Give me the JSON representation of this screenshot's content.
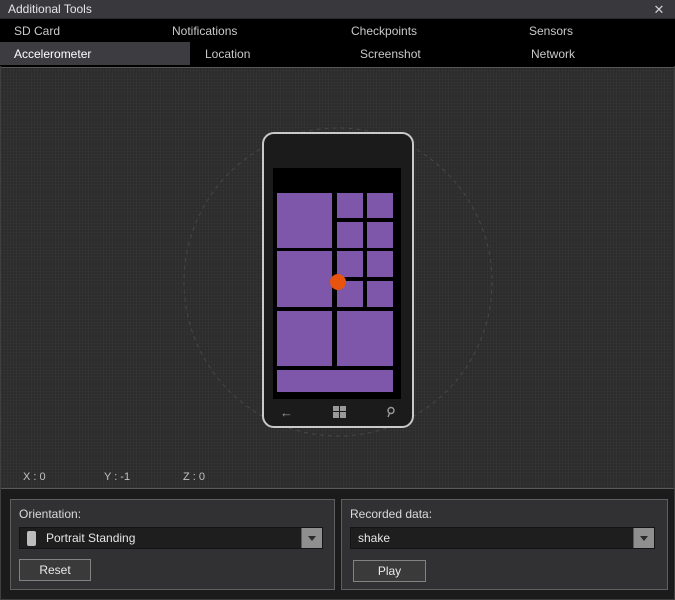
{
  "window": {
    "title": "Additional Tools",
    "close_glyph": "✕"
  },
  "tabs": {
    "row1": [
      {
        "label": "SD Card"
      },
      {
        "label": "Notifications"
      },
      {
        "label": "Checkpoints"
      },
      {
        "label": "Sensors"
      }
    ],
    "row2": [
      {
        "label": "Accelerometer"
      },
      {
        "label": "Location"
      },
      {
        "label": "Screenshot"
      },
      {
        "label": "Network"
      }
    ],
    "selected": "Accelerometer"
  },
  "accelerometer": {
    "readout_x": "X : 0",
    "readout_y": "Y : -1",
    "readout_z": "Z : 0"
  },
  "orientation_panel": {
    "label": "Orientation:",
    "value": "Portrait Standing",
    "button_label": "Reset"
  },
  "recorded_panel": {
    "label": "Recorded data:",
    "value": "shake",
    "button_label": "Play"
  },
  "colors": {
    "tile_purple": "#7f57aa",
    "dot_orange": "#e8530e",
    "circle_stroke": "#474747"
  },
  "phone_screen": {
    "tiles": [
      [
        4,
        25,
        55,
        55
      ],
      [
        64,
        25,
        26,
        25
      ],
      [
        94,
        25,
        26,
        25
      ],
      [
        64,
        54,
        26,
        26
      ],
      [
        94,
        54,
        26,
        26
      ],
      [
        4,
        83,
        55,
        56
      ],
      [
        64,
        83,
        26,
        26
      ],
      [
        94,
        83,
        26,
        26
      ],
      [
        64,
        113,
        26,
        26
      ],
      [
        94,
        113,
        26,
        26
      ],
      [
        4,
        143,
        55,
        55
      ],
      [
        64,
        143,
        56,
        55
      ],
      [
        4,
        202,
        116,
        22
      ]
    ]
  }
}
